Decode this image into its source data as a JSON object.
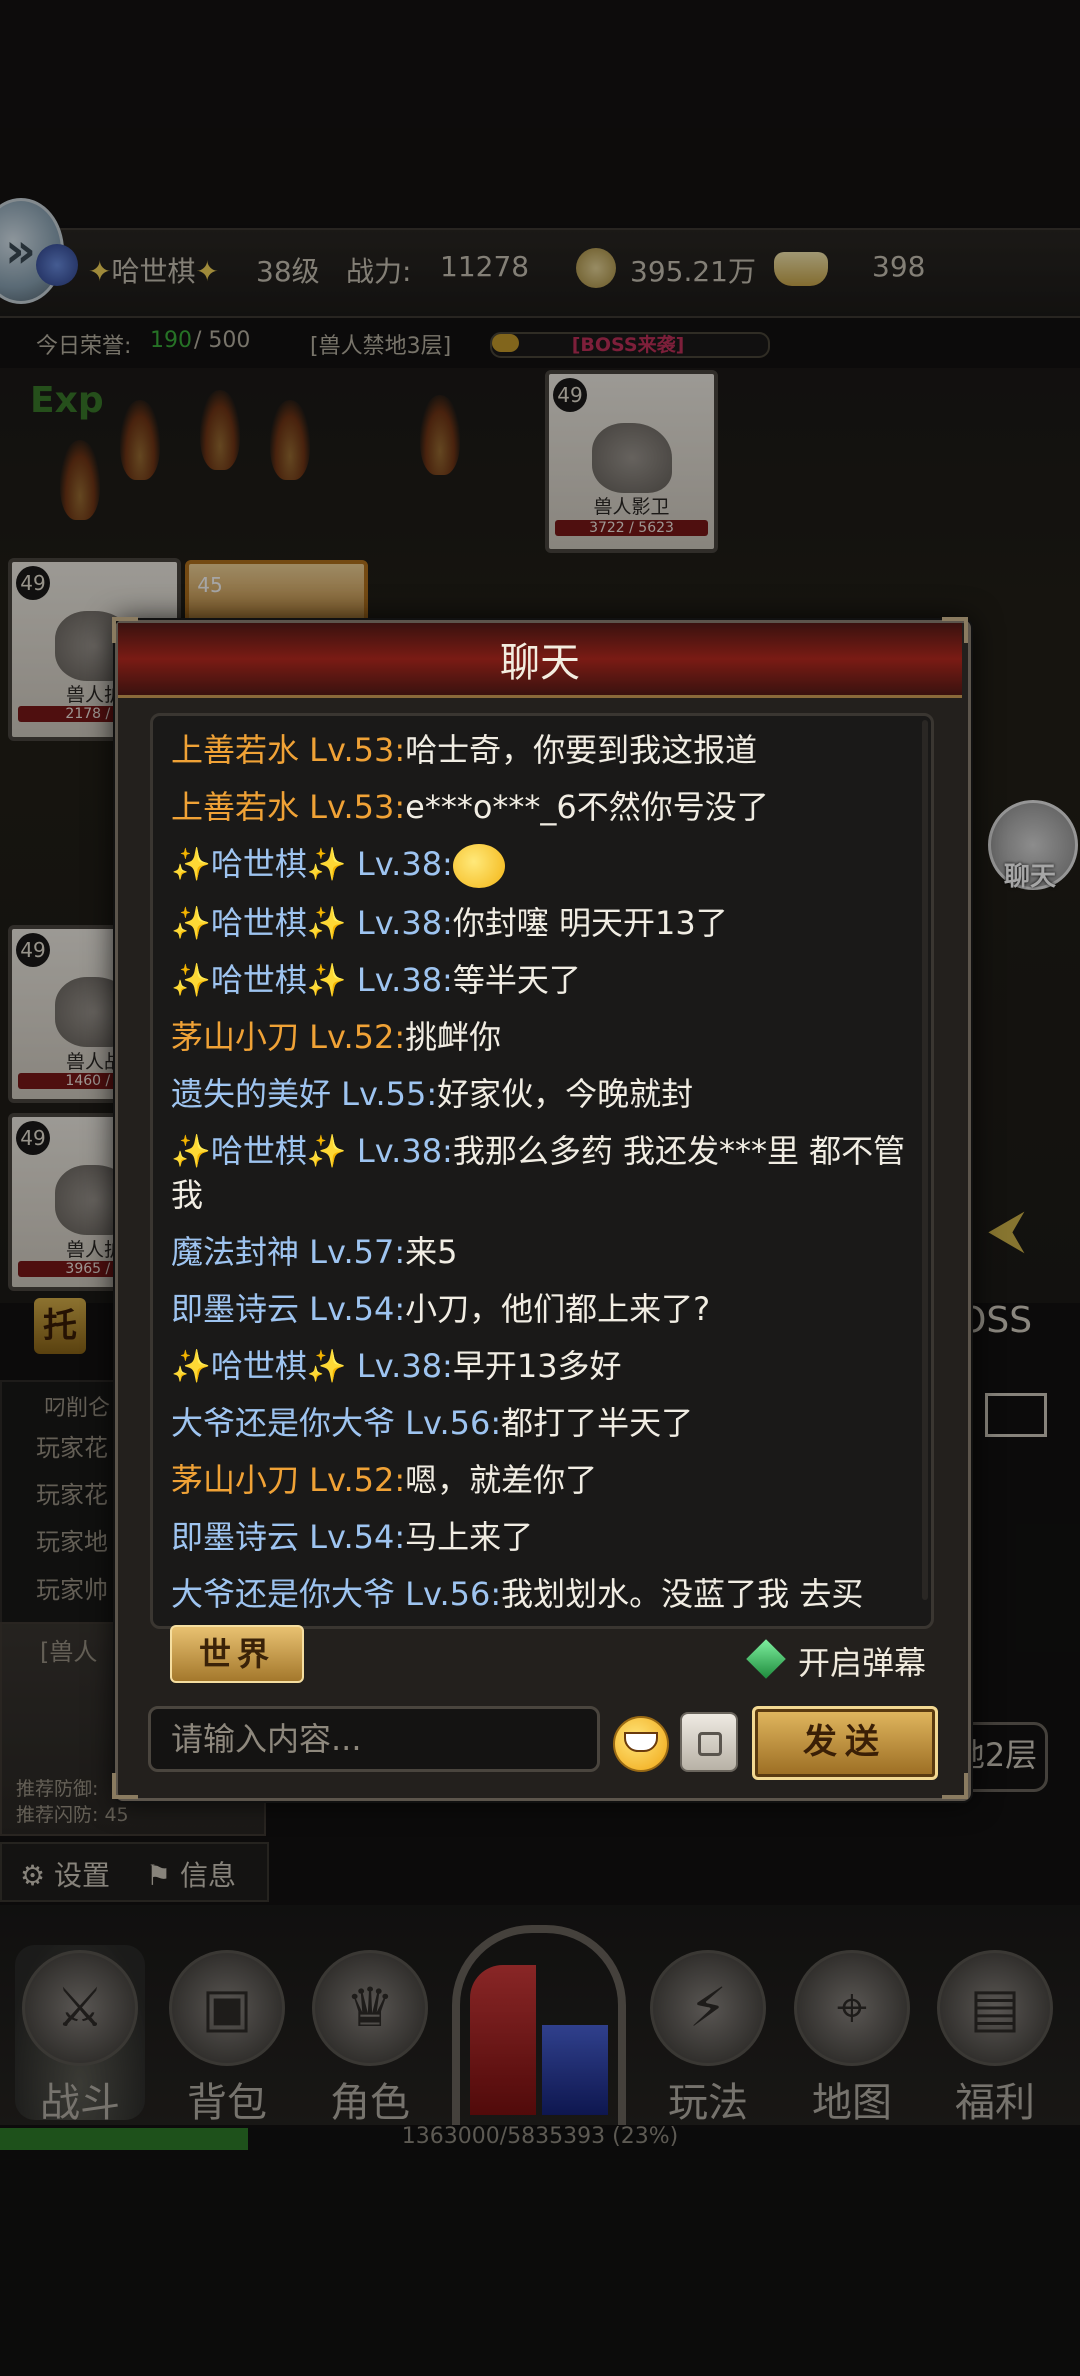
{
  "status_bar": {
    "player_name": "哈世棋",
    "level": "38级",
    "power_label": "战力:",
    "power_value": "11278",
    "copper": "395.21万",
    "ingot": "398"
  },
  "honor_row": {
    "label": "今日荣誉:",
    "current": "190",
    "max": "/ 500",
    "stage": "[兽人禁地3层]",
    "boss_label": "[BOSS来袭]",
    "boss_progress": 0.1,
    "exp_float": "Exp"
  },
  "enemies": [
    {
      "level": "49",
      "name": "兽人影卫",
      "hp": "3722 / 5623"
    },
    {
      "level": "49",
      "name": "兽人护",
      "hp": "2178 / 5"
    },
    {
      "level": "45",
      "name": "",
      "hp": ""
    },
    {
      "level": "49",
      "name": "兽人战",
      "hp": "1460 / 5"
    },
    {
      "level": "49",
      "name": "兽人护",
      "hp": "3965 / 5"
    }
  ],
  "side_left": {
    "tuo": "托",
    "log_title": "叼削仑",
    "log_lines": [
      "玩家花",
      "玩家花",
      "玩家地",
      "玩家帅"
    ],
    "area": "[兽人",
    "rec_def": "推荐防御:",
    "rec_dodge": "推荐闪防:",
    "rec_dodge_value": "45",
    "settings": "设置",
    "info": "信息"
  },
  "side_right": {
    "chat": "聊天",
    "boss": "OSS",
    "floor": "地2层"
  },
  "chat": {
    "title": "聊天",
    "messages": [
      {
        "name": "上善若水 Lv.53:",
        "gold": true,
        "spark": false,
        "text": "哈士奇，你要到我这报道"
      },
      {
        "name": "上善若水 Lv.53:",
        "gold": true,
        "spark": false,
        "text": "e***o***_6不然你号没了"
      },
      {
        "name": "哈世棋",
        "lv": " Lv.38:",
        "gold": false,
        "spark": true,
        "text": "",
        "emoji": true
      },
      {
        "name": "哈世棋",
        "lv": " Lv.38:",
        "gold": false,
        "spark": true,
        "text": "你封噻 明天开13了"
      },
      {
        "name": "哈世棋",
        "lv": " Lv.38:",
        "gold": false,
        "spark": true,
        "text": "等半天了"
      },
      {
        "name": "茅山小刀 Lv.52:",
        "gold": true,
        "spark": false,
        "text": "挑衅你"
      },
      {
        "name": "遗失的美好 Lv.55:",
        "gold": false,
        "spark": false,
        "text": "好家伙，今晚就封"
      },
      {
        "name": "哈世棋",
        "lv": " Lv.38:",
        "gold": false,
        "spark": true,
        "text": "我那么多药 我还发***里 都不管我"
      },
      {
        "name": "魔法封神 Lv.57:",
        "gold": false,
        "spark": false,
        "text": "来5"
      },
      {
        "name": "即墨诗云 Lv.54:",
        "gold": false,
        "spark": false,
        "text": "小刀，他们都上来了?"
      },
      {
        "name": "哈世棋",
        "lv": " Lv.38:",
        "gold": false,
        "spark": true,
        "text": "早开13多好"
      },
      {
        "name": "大爷还是你大爷 Lv.56:",
        "gold": false,
        "spark": false,
        "text": "都打了半天了"
      },
      {
        "name": "茅山小刀 Lv.52:",
        "gold": true,
        "spark": false,
        "text": "嗯，就差你了"
      },
      {
        "name": "即墨诗云 Lv.54:",
        "gold": false,
        "spark": false,
        "text": "马上来了"
      },
      {
        "name": "大爷还是你大爷 Lv.56:",
        "gold": false,
        "spark": false,
        "text": "我划划水。没蓝了我 去买"
      }
    ],
    "world_tab": "世界",
    "danmaku": "开启弹幕",
    "input_placeholder": "请输入内容...",
    "send": "发送"
  },
  "bottom_nav": {
    "items": [
      "战斗",
      "背包",
      "角色",
      "玩法",
      "地图",
      "福利"
    ],
    "exp_text": "1363000/5835393 (23%)",
    "exp_fraction": 0.23
  },
  "colors": {
    "gold_name": "#f0a236",
    "blue_name": "#9ec4f0",
    "header_red": "#7a1b14"
  }
}
